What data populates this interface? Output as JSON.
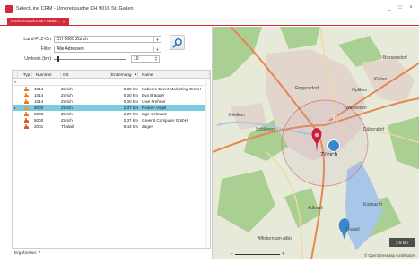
{
  "window": {
    "title": "SelectLine CRM - Umkreissuche CH 9016 St. Gallen",
    "controls": [
      "_",
      "□",
      "×"
    ]
  },
  "tab": {
    "label": "Umkreissuche CH 9000...",
    "close": "×"
  },
  "form": {
    "land_label": "Land-PLZ-Ort",
    "land_value": "CH 8000 Zürich",
    "filter_label": "Filter",
    "filter_value": "Alle Adressen",
    "umkreis_label": "Umkreis (km)",
    "umkreis_value": "10",
    "umkreis_fraction": 0.05
  },
  "grid": {
    "columns": {
      "typ": "Typ",
      "nummer": "Nummer",
      "ort": "Ort",
      "entfernung": "Entfernung",
      "name": "Name"
    },
    "sort_indicator": "▲",
    "filter_marker": "▼",
    "rows": [
      {
        "indicator": "",
        "icon_color": "#e87a1c",
        "nummer": "1014",
        "ort": "Zürich",
        "entfernung": "0,00 km",
        "name": "Kaboom Event Marketing GmbH",
        "selected": false
      },
      {
        "indicator": "",
        "icon_color": "#e87a1c",
        "nummer": "1014",
        "ort": "Zürich",
        "entfernung": "0,00 km",
        "name": "Eva Brägger",
        "selected": false
      },
      {
        "indicator": "",
        "icon_color": "#e87a1c",
        "nummer": "1014",
        "ort": "Zürich",
        "entfernung": "0,00 km",
        "name": "Uwe Frehner",
        "selected": false
      },
      {
        "indicator": "▸",
        "icon_color": "#e0a030",
        "nummer": "5003",
        "ort": "Zürich",
        "entfernung": "2,37 km",
        "name": "Reiben Vogel",
        "selected": true
      },
      {
        "indicator": "",
        "icon_color": "#e87a1c",
        "nummer": "5003",
        "ort": "Zürich",
        "entfernung": "2,37 km",
        "name": "Inge Schwarz",
        "selected": false
      },
      {
        "indicator": "",
        "icon_color": "#d25a20",
        "nummer": "5003",
        "ort": "Zürich",
        "entfernung": "2,37 km",
        "name": "Greenit Computer GmbH",
        "selected": false
      },
      {
        "indicator": "",
        "icon_color": "#d25a20",
        "nummer": "2001",
        "ort": "Thalwil",
        "entfernung": "8,43 km",
        "name": "Züger",
        "selected": false
      }
    ]
  },
  "result": {
    "label": "Ergebnisse: 7"
  },
  "map": {
    "labels": {
      "regensdorf": "Regensdorf",
      "dietikon": "Dietikon",
      "schlieren": "Schlieren",
      "zuerich": "Zürich",
      "dubendorf": "Dübendorf",
      "wallisellen": "Wallisellen",
      "opfikon": "Opfikon",
      "kloten": "Kloten",
      "bassersdorf": "Bassersdorf",
      "adliswil": "Adliswil",
      "kusnacht": "Küsnacht",
      "affoltern": "Affoltern am Albis",
      "thalwil": "Thalwil"
    },
    "cluster_count": "3",
    "scale_label": "2.5 km",
    "attribution": "© OpenStreetMap contributors",
    "colors": {
      "land": "#e7ead8",
      "urban": "#e2d6cc",
      "forest": "#a9cf93",
      "water": "#a7c6e8",
      "highway": "#e5874e",
      "road": "#f2d9a0",
      "marker_red": "#c81e3c",
      "marker_blue": "#3a88c9"
    }
  }
}
